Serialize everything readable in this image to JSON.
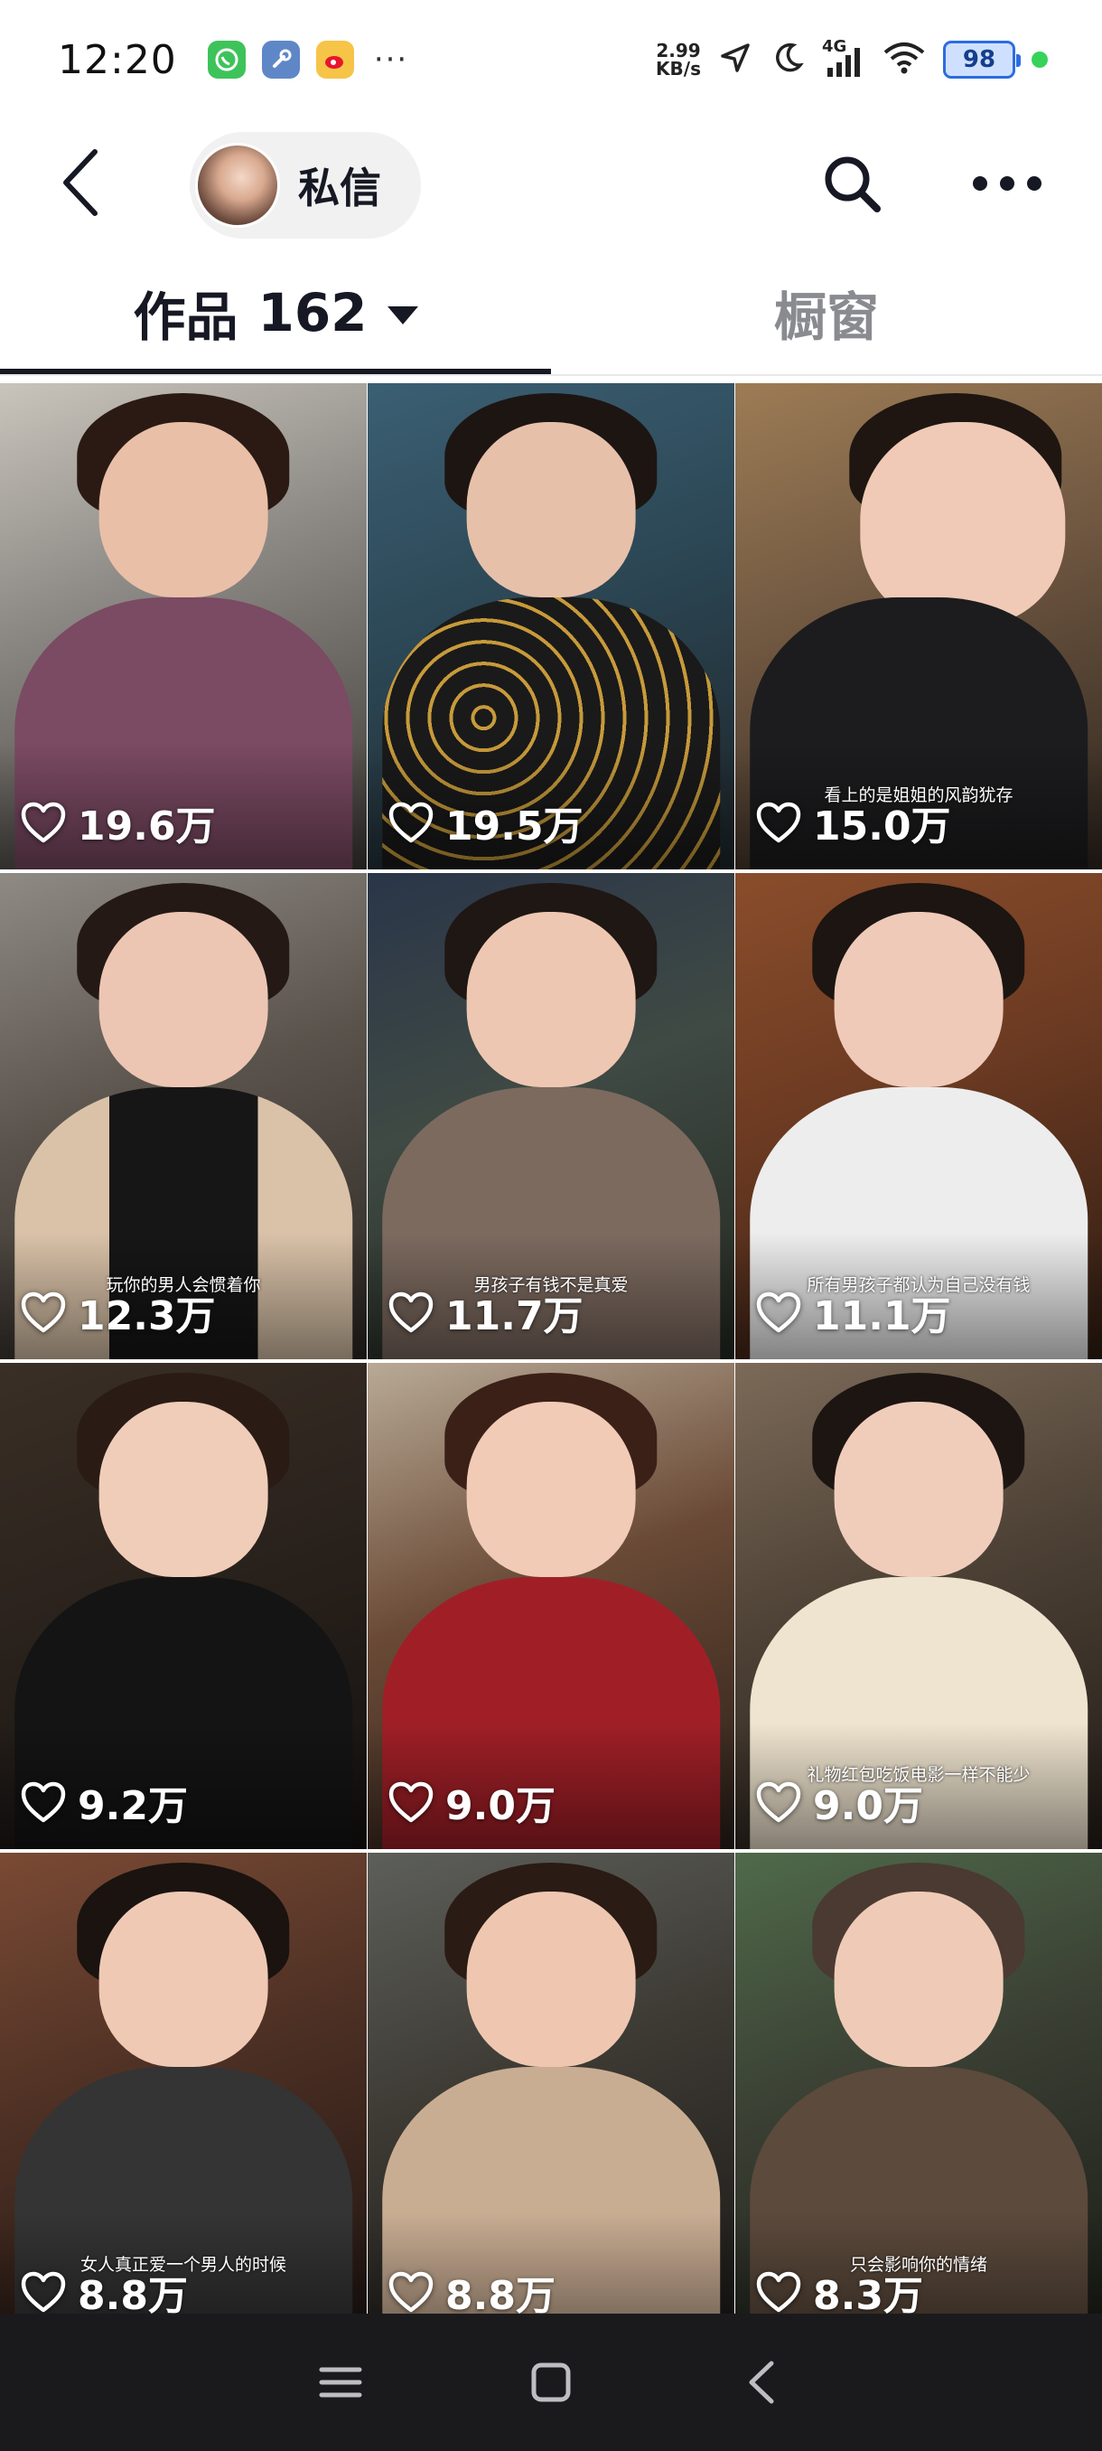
{
  "status_bar": {
    "time": "12:20",
    "apps": [
      {
        "name": "whatsapp-icon",
        "color": "#3ec35a"
      },
      {
        "name": "tools-icon",
        "color": "#5f87c7"
      },
      {
        "name": "weibo-icon",
        "color": "#f6c447"
      }
    ],
    "more": "···",
    "net_speed_value": "2.99",
    "net_speed_unit": "KB/s",
    "network_type": "4G",
    "battery": "98"
  },
  "header": {
    "dm_label": "私信"
  },
  "tabs": {
    "works_label": "作品",
    "works_count": "162",
    "showcase_label": "橱窗"
  },
  "videos": [
    {
      "likes": "19.6万",
      "caption": ""
    },
    {
      "likes": "19.5万",
      "caption": ""
    },
    {
      "likes": "15.0万",
      "caption": "看上的是姐姐的风韵犹存"
    },
    {
      "likes": "12.3万",
      "caption": "玩你的男人会惯着你"
    },
    {
      "likes": "11.7万",
      "caption": "男孩子有钱不是真爱"
    },
    {
      "likes": "11.1万",
      "caption": "所有男孩子都认为自己没有钱"
    },
    {
      "likes": "9.2万",
      "caption": ""
    },
    {
      "likes": "9.0万",
      "caption": ""
    },
    {
      "likes": "9.0万",
      "caption": "礼物红包吃饭电影一样不能少"
    },
    {
      "likes": "8.8万",
      "caption": "女人真正爱一个男人的时候"
    },
    {
      "likes": "8.8万",
      "caption": ""
    },
    {
      "likes": "8.3万",
      "caption": "只会影响你的情绪"
    }
  ]
}
